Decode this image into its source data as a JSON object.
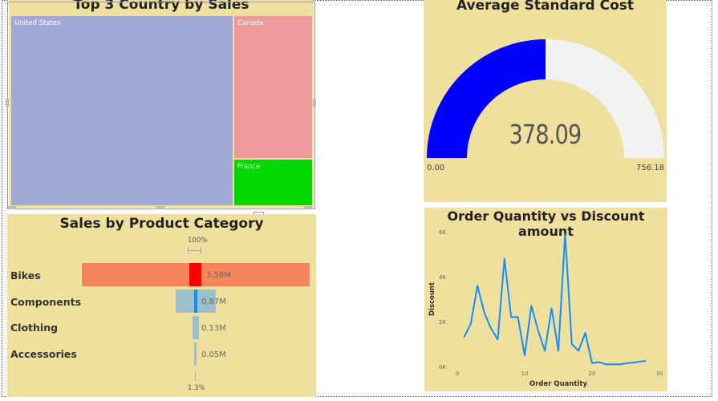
{
  "treemap": {
    "title": "Top 3 Country by Sales",
    "cells": [
      {
        "label": "United States",
        "color": "#a0a8d6"
      },
      {
        "label": "Canada",
        "color": "#ef9a9a"
      },
      {
        "label": "France",
        "color": "#00d800"
      }
    ]
  },
  "gauge": {
    "title": "Average Standard Cost",
    "value": "378.09",
    "min_label": "0.00",
    "max_label": "756.18",
    "fraction": 0.5,
    "fill_color": "#0000ff",
    "track_color": "#f2f2f2"
  },
  "funnel": {
    "title": "Sales by Product Category",
    "top_pct": "100%",
    "bottom_pct": "1.3%",
    "rows": [
      {
        "category": "Bikes",
        "value_label": "3.56M",
        "value": 3.56
      },
      {
        "category": "Components",
        "value_label": "0.87M",
        "value": 0.87
      },
      {
        "category": "Clothing",
        "value_label": "0.13M",
        "value": 0.13
      },
      {
        "category": "Accessories",
        "value_label": "0.05M",
        "value": 0.05
      }
    ]
  },
  "chart_data": {
    "type": "line",
    "title": "Order Quantity vs Discount amount",
    "xlabel": "Order Quantity",
    "ylabel": "Discount",
    "xlim": [
      0,
      30
    ],
    "ylim": [
      0,
      6000
    ],
    "x_ticks": [
      "0",
      "10",
      "20",
      "30"
    ],
    "y_ticks": [
      "0K",
      "2K",
      "4K",
      "6K"
    ],
    "grid": false,
    "series": [
      {
        "color": "#118dff",
        "x": [
          1,
          2,
          3,
          4,
          5,
          6,
          7,
          8,
          9,
          10,
          11,
          12,
          13,
          14,
          15,
          16,
          17,
          18,
          19,
          20,
          21,
          22,
          24,
          28
        ],
        "y": [
          1300,
          1900,
          3600,
          2400,
          1700,
          1200,
          4800,
          2200,
          2200,
          500,
          2700,
          1600,
          700,
          2600,
          700,
          5900,
          1000,
          700,
          1500,
          150,
          200,
          100,
          100,
          250
        ]
      }
    ]
  }
}
